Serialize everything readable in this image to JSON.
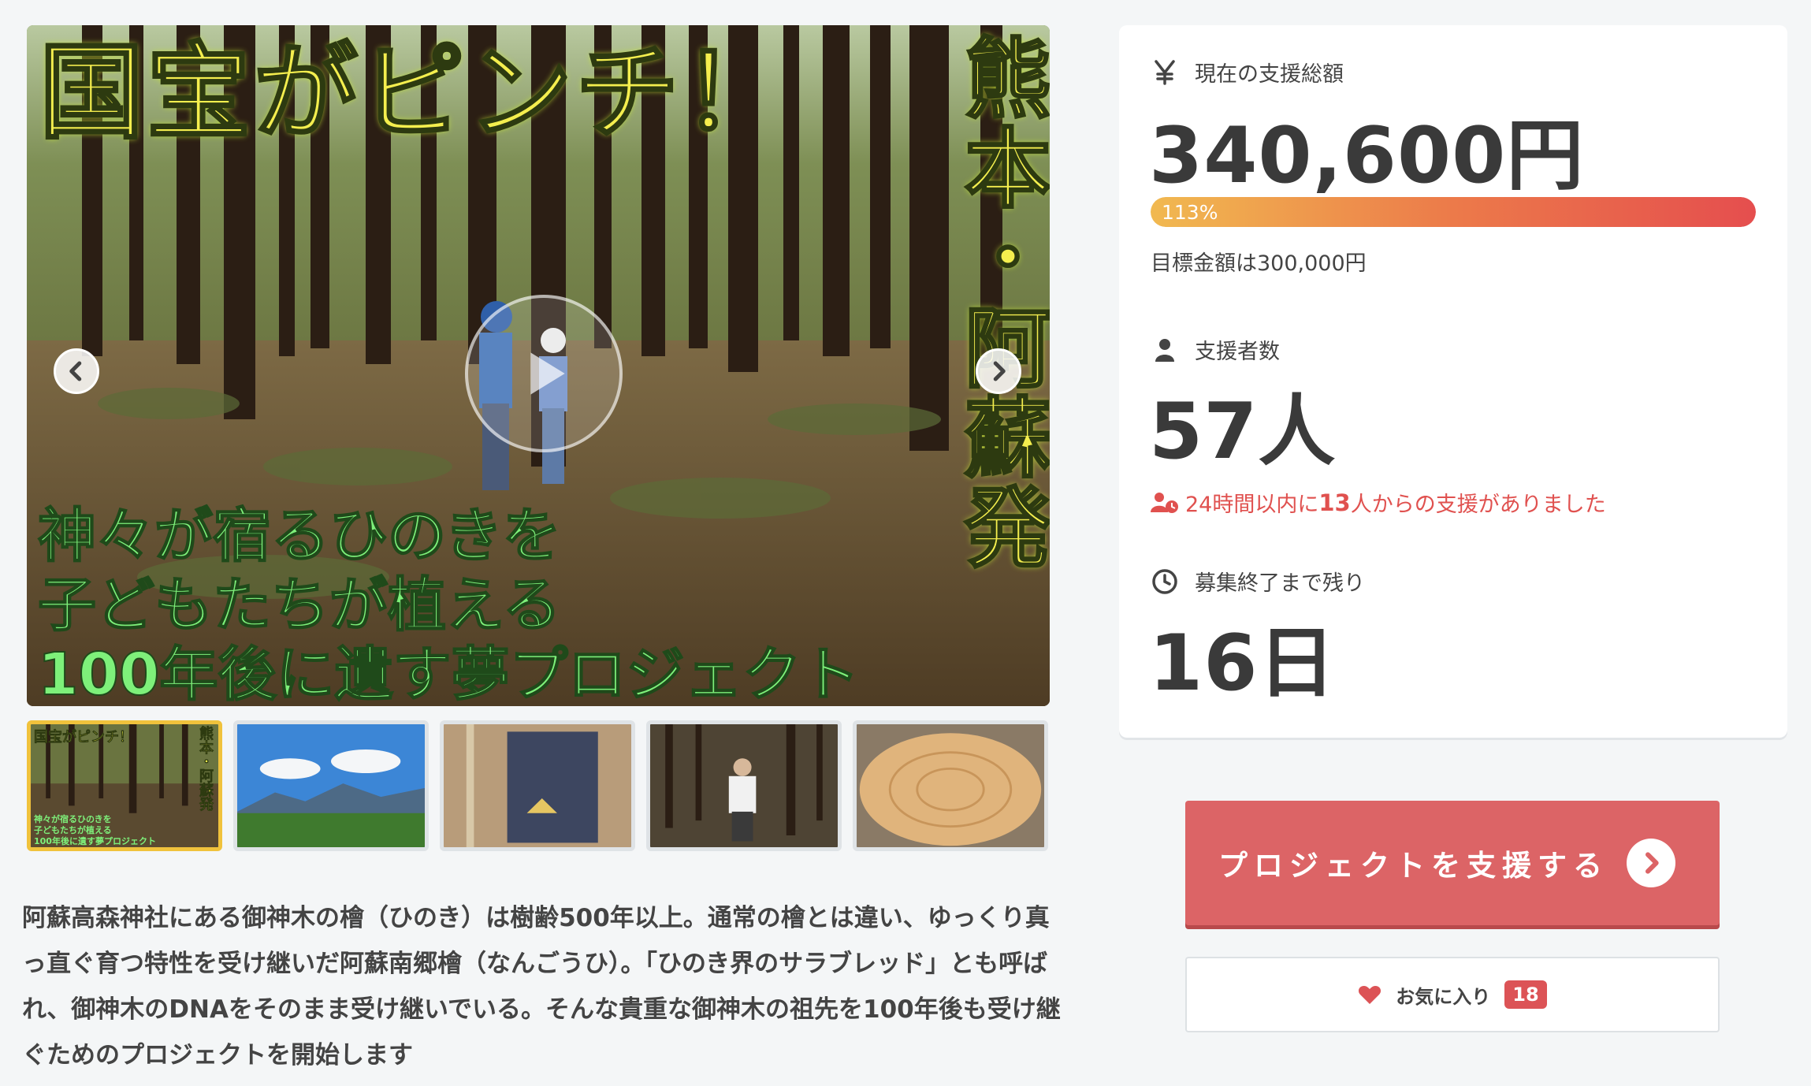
{
  "hero": {
    "title": "国宝がピンチ！",
    "vertical": "熊本・阿蘇発",
    "sub_lines": [
      "神々が宿るひのきを",
      "子どもたちが植える",
      "100年後に遺す夢プロジェクト"
    ]
  },
  "thumbnails": [
    {
      "label": "国宝がピンチ！",
      "vertical": "熊本・阿蘇発",
      "sub": [
        "神々が宿るひのきを",
        "子どもたちが植える",
        "100年後に遺す夢プロジェクト"
      ],
      "active": true
    },
    {
      "scene": "mountain-landscape"
    },
    {
      "scene": "banner-flag"
    },
    {
      "scene": "person-in-forest"
    },
    {
      "scene": "tree-stump"
    }
  ],
  "description": "阿蘇高森神社にある御神木の檜（ひのき）は樹齢500年以上。通常の檜とは違い、ゆっくり真っ直ぐ育つ特性を受け継いだ阿蘇南郷檜（なんごうひ）。「ひのき界のサラブレッド」とも呼ばれ、御神木のDNAをそのまま受け継いでいる。そんな貴重な御神木の祖先を100年後も受け継ぐためのプロジェクトを開始します",
  "stats": {
    "total_label": "現在の支援総額",
    "total_value": "340,600円",
    "progress_text": "113%",
    "progress_fraction": 1.0,
    "goal_text": "目標金額は300,000円",
    "supporters_label": "支援者数",
    "supporters_value": "57人",
    "recent_prefix": "24時間以内に",
    "recent_count": "13",
    "recent_suffix": "人からの支援がありました",
    "remaining_label": "募集終了まで残り",
    "remaining_value": "16日"
  },
  "actions": {
    "support_label": "プロジェクトを支援する",
    "favorite_label": "お気に入り",
    "favorite_count": "18"
  },
  "colors": {
    "accent": "#dc6466",
    "progress_start": "#f1b950",
    "progress_end": "#e54e4e",
    "recent_text": "#e0514f"
  }
}
